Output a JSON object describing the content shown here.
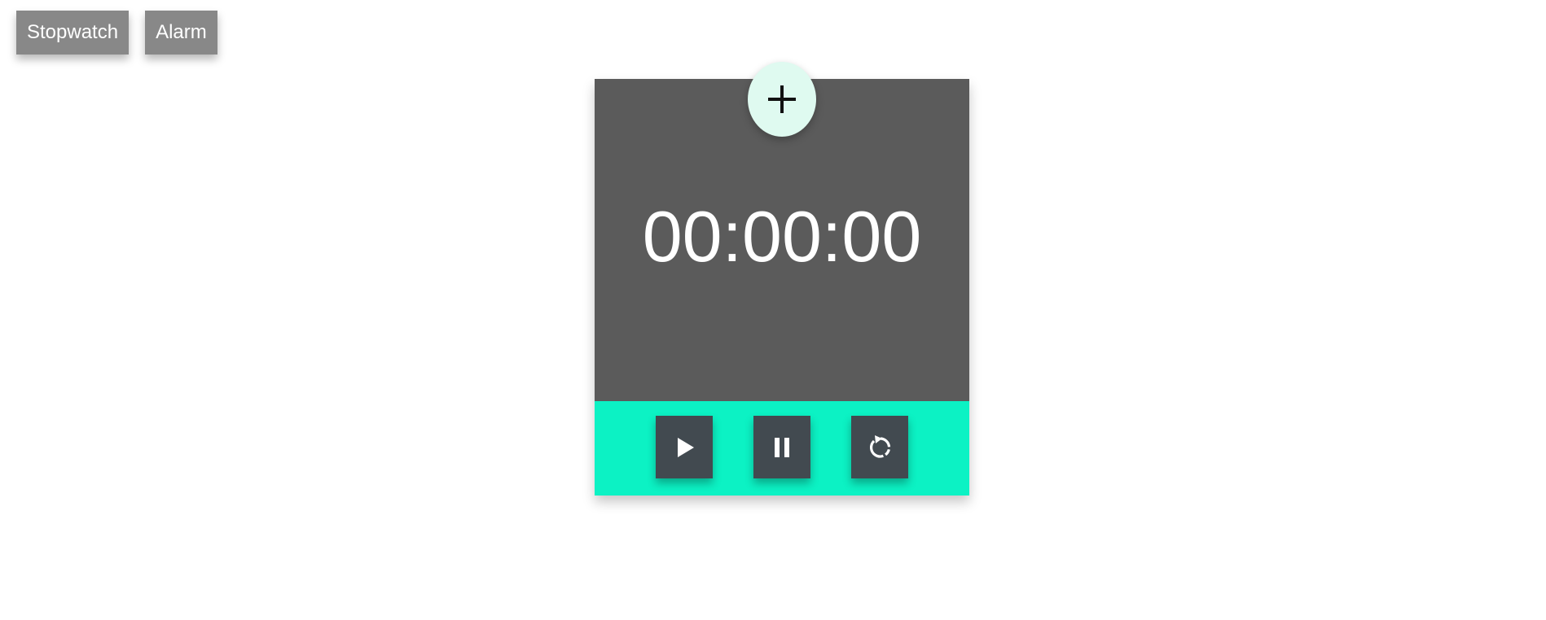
{
  "nav": {
    "stopwatch_label": "Stopwatch",
    "alarm_label": "Alarm"
  },
  "timer": {
    "display": "00:00:00"
  },
  "controls": {
    "add_icon": "plus-icon",
    "play_icon": "play-icon",
    "pause_icon": "pause-icon",
    "reset_icon": "reset-icon"
  },
  "colors": {
    "nav_button_bg": "#888888",
    "display_bg": "#5b5b5b",
    "controls_bg": "#0cf2c4",
    "control_button_bg": "#424a50",
    "add_button_bg": "#dffaf0",
    "text": "#ffffff"
  }
}
